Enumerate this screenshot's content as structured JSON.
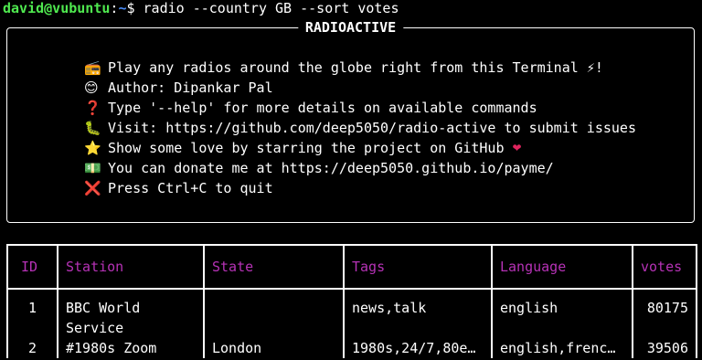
{
  "prompt": {
    "user_host": "david@vubuntu",
    "path": "~",
    "symbol": "$",
    "command": "radio --country GB --sort votes"
  },
  "banner": {
    "title": "RADIOACTIVE",
    "lines": [
      {
        "icon": "📻",
        "icon_name": "radio-icon",
        "text": "Play any radios around the globe right from this Terminal ⚡!"
      },
      {
        "icon": "😊",
        "icon_name": "smile-icon",
        "text": "Author: Dipankar Pal"
      },
      {
        "icon": "❓",
        "icon_name": "question-icon",
        "text": "Type '--help' for more details on available commands"
      },
      {
        "icon": "🐛",
        "icon_name": "bug-icon",
        "text": "Visit: https://github.com/deep5050/radio-active to submit issues"
      },
      {
        "icon": "⭐",
        "icon_name": "star-icon",
        "text": "Show some love by starring the project on GitHub"
      },
      {
        "icon": "💵",
        "icon_name": "money-icon",
        "text": "You can donate me at https://deep5050.github.io/payme/"
      },
      {
        "icon": "❌",
        "icon_name": "cross-icon",
        "text": "Press Ctrl+C to quit"
      }
    ],
    "heart": "❤"
  },
  "table": {
    "columns": [
      "ID",
      "Station",
      "State",
      "Tags",
      "Language",
      "votes"
    ],
    "rows": [
      {
        "id": "1",
        "station": "BBC World Service",
        "state": "",
        "tags": "news,talk",
        "language": "english",
        "votes": "80175"
      },
      {
        "id": "2",
        "station": "#1980s Zoom",
        "state": "London",
        "tags": "1980s,24/7,80e…",
        "language": "english,frenc…",
        "votes": "39506"
      }
    ]
  },
  "colors": {
    "background": "#000000",
    "prompt_user": "#4fe84f",
    "prompt_path": "#4a8cf7",
    "header_text": "#b632b6",
    "heart": "#e0245e"
  }
}
